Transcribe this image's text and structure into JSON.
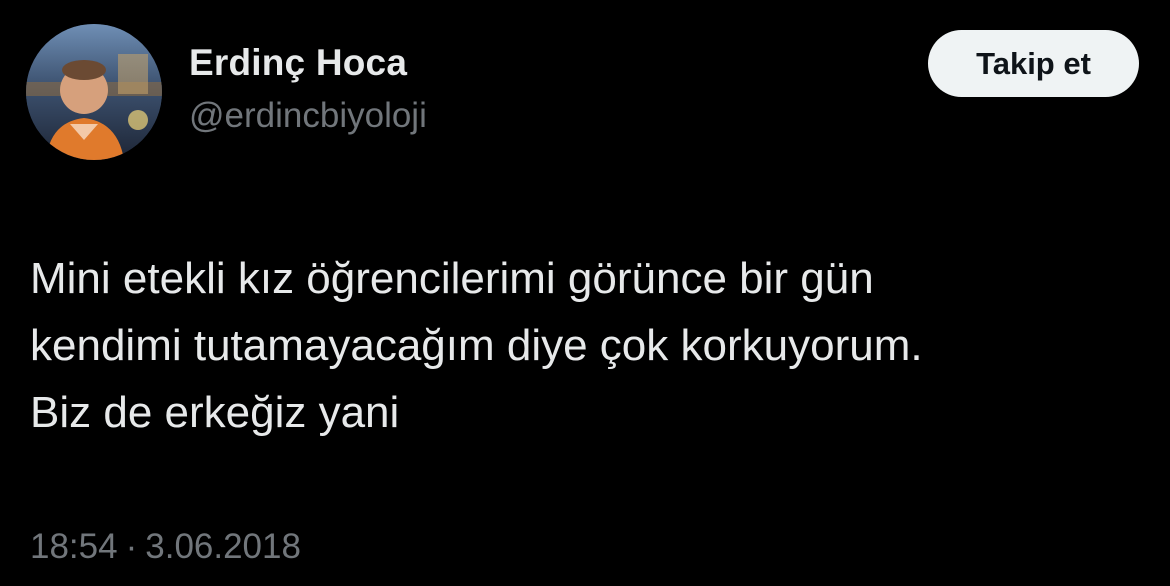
{
  "author": {
    "display_name": "Erdinç Hoca",
    "handle": "@erdincbiyoloji"
  },
  "follow_button": {
    "label": "Takip et"
  },
  "tweet": {
    "lines": [
      "Mini etekli kız öğrencilerimi görünce bir gün",
      "kendimi tutamayacağım diye çok korkuyorum.",
      "Biz de erkeğiz yani"
    ],
    "time": "18:54",
    "separator": "·",
    "date": "3.06.2018"
  },
  "colors": {
    "background": "#000000",
    "primary_text": "#e7e9ea",
    "secondary_text": "#71767b",
    "button_background": "#eff3f4",
    "button_text": "#0f1419"
  }
}
